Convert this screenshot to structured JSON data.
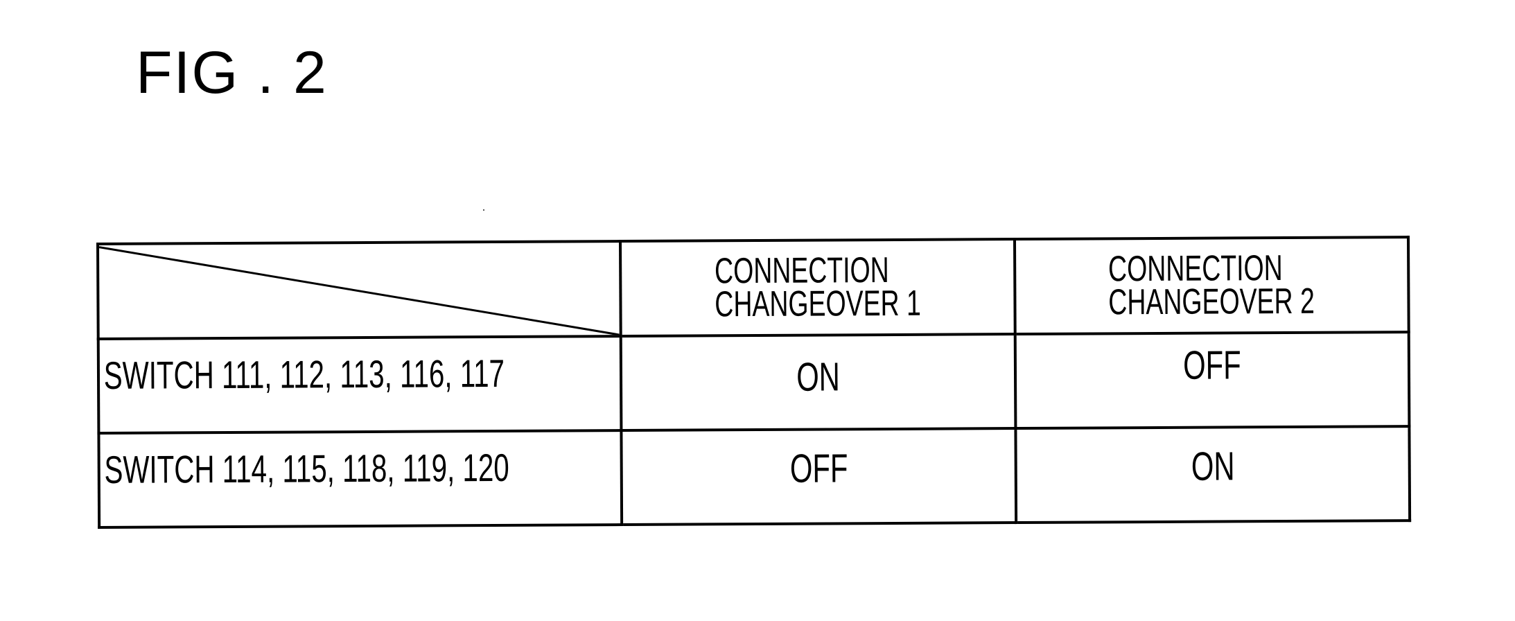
{
  "figure": {
    "title": "FIG . 2"
  },
  "table": {
    "corner": "",
    "columns": [
      {
        "label_line1": "CONNECTION",
        "label_line2": "CHANGEOVER 1"
      },
      {
        "label_line1": "CONNECTION",
        "label_line2": "CHANGEOVER 2"
      }
    ],
    "rows": [
      {
        "label": "SWITCH 111, 112, 113, 116, 117",
        "values": [
          "ON",
          "OFF"
        ]
      },
      {
        "label": "SWITCH 114, 115, 118, 119, 120",
        "values": [
          "OFF",
          "ON"
        ]
      }
    ]
  }
}
